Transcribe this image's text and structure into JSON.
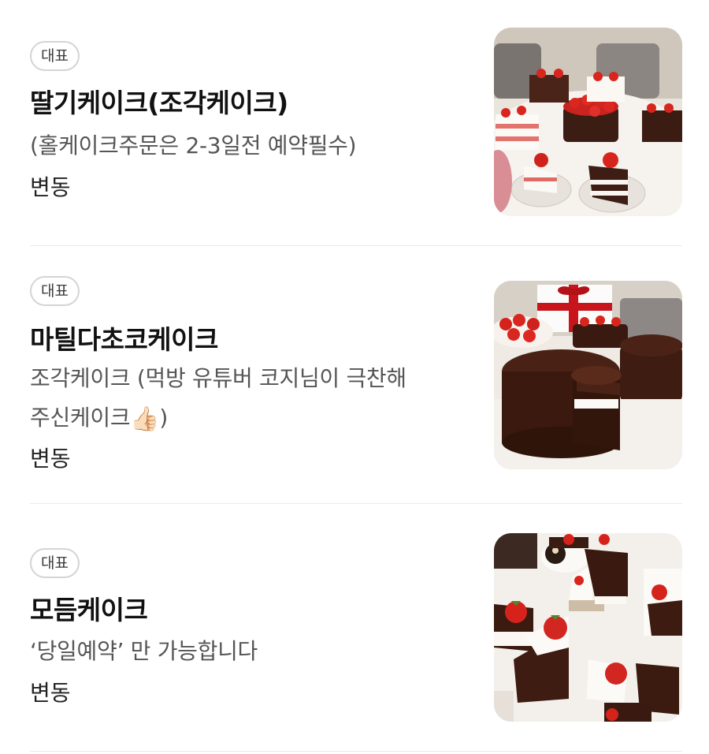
{
  "menu": {
    "items": [
      {
        "badge": "대표",
        "title": "딸기케이크(조각케이크)",
        "description": "(홀케이크주문은 2-3일전 예약필수)",
        "price": "변동",
        "photo": "strawberry-cake-photo"
      },
      {
        "badge": "대표",
        "title": "마틸다초코케이크",
        "description_line1": "조각케이크 (먹방 유튜버 코지님이 극찬해",
        "description_line2_prefix": "주신케이크",
        "description_icon": "thumbs-up-icon",
        "description_line2_suffix": ")",
        "price": "변동",
        "photo": "chocolate-cake-photo"
      },
      {
        "badge": "대표",
        "title": "모듬케이크",
        "description": "‘당일예약’ 만 가능합니다",
        "price": "변동",
        "photo": "assorted-cake-photo"
      }
    ]
  },
  "colors": {
    "divider": "#eaeaea",
    "badge_border": "#d4d4d4",
    "description": "#555555"
  }
}
